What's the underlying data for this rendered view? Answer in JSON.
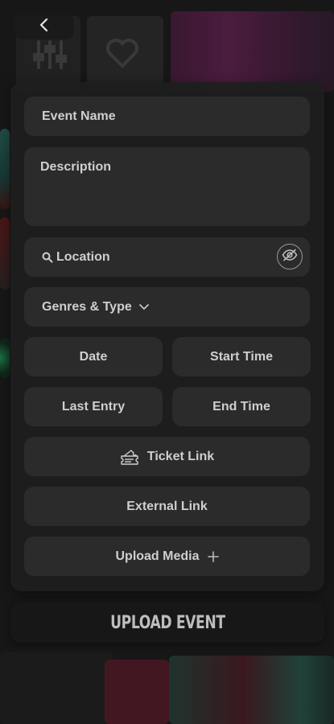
{
  "form": {
    "event_name_placeholder": "Event Name",
    "description_placeholder": "Description",
    "location_placeholder": "Location",
    "genres_label": "Genres & Type",
    "date_label": "Date",
    "start_time_label": "Start Time",
    "last_entry_label": "Last Entry",
    "end_time_label": "End Time",
    "ticket_link_label": "Ticket Link",
    "external_link_label": "External Link",
    "upload_media_label": "Upload Media"
  },
  "actions": {
    "upload_event_label": "UPLOAD EVENT"
  },
  "icons": {
    "back": "chevron-left-icon",
    "search": "search-icon",
    "visibility": "eye-off-icon",
    "dropdown": "chevron-down-icon",
    "ticket": "ticket-icon",
    "plus": "plus-icon"
  },
  "colors": {
    "panel": "#1e1e1e",
    "field": "#2b2b2b",
    "text": "#cfcfcf"
  }
}
